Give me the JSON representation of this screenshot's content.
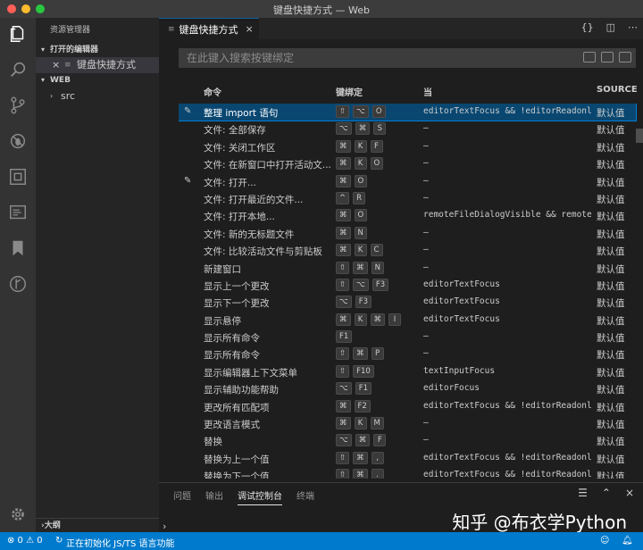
{
  "window": {
    "title": "键盘快捷方式 — Web"
  },
  "sidebar": {
    "title": "资源管理器",
    "open_editors_label": "打开的编辑器",
    "open_editor_item": "键盘快捷方式",
    "workspace_label": "WEB",
    "folder_src": "src",
    "outline_label": "大纲"
  },
  "tab": {
    "label": "键盘快捷方式",
    "close": "×"
  },
  "search": {
    "placeholder": "在此键入搜索按键绑定"
  },
  "columns": {
    "command": "命令",
    "keybinding": "键绑定",
    "when": "当",
    "source": "SOURCE"
  },
  "rows": [
    {
      "edit": "✎",
      "command": "整理 import 语句",
      "keys": [
        "⇧",
        "⌥",
        "O"
      ],
      "when": "editorTextFocus && !editorReadonly",
      "source": "默认值",
      "selected": true
    },
    {
      "edit": "",
      "command": "文件: 全部保存",
      "keys": [
        "⌥",
        "⌘",
        "S"
      ],
      "when": "—",
      "source": "默认值"
    },
    {
      "edit": "",
      "command": "文件: 关闭工作区",
      "keys": [
        "⌘",
        "K",
        "F"
      ],
      "when": "—",
      "source": "默认值"
    },
    {
      "edit": "",
      "command": "文件: 在新窗口中打开活动文...",
      "keys": [
        "⌘",
        "K",
        "O"
      ],
      "when": "—",
      "source": "默认值"
    },
    {
      "edit": "✎",
      "command": "文件: 打开...",
      "keys": [
        "⌘",
        "O"
      ],
      "when": "—",
      "source": "默认值"
    },
    {
      "edit": "",
      "command": "文件: 打开最近的文件...",
      "keys": [
        "^",
        "R"
      ],
      "when": "—",
      "source": "默认值"
    },
    {
      "edit": "",
      "command": "文件: 打开本地...",
      "keys": [
        "⌘",
        "O"
      ],
      "when": "remoteFileDialogVisible && remoteFileDialog",
      "source": "默认值"
    },
    {
      "edit": "",
      "command": "文件: 新的无标题文件",
      "keys": [
        "⌘",
        "N"
      ],
      "when": "—",
      "source": "默认值"
    },
    {
      "edit": "",
      "command": "文件: 比较活动文件与剪贴板",
      "keys": [
        "⌘",
        "K",
        "C"
      ],
      "when": "—",
      "source": "默认值"
    },
    {
      "edit": "",
      "command": "新建窗口",
      "keys": [
        "⇧",
        "⌘",
        "N"
      ],
      "when": "—",
      "source": "默认值"
    },
    {
      "edit": "",
      "command": "显示上一个更改",
      "keys": [
        "⇧",
        "⌥",
        "F3"
      ],
      "when": "editorTextFocus",
      "source": "默认值"
    },
    {
      "edit": "",
      "command": "显示下一个更改",
      "keys": [
        "⌥",
        "F3"
      ],
      "when": "editorTextFocus",
      "source": "默认值"
    },
    {
      "edit": "",
      "command": "显示悬停",
      "keys": [
        "⌘",
        "K",
        "⌘",
        "I"
      ],
      "when": "editorTextFocus",
      "source": "默认值"
    },
    {
      "edit": "",
      "command": "显示所有命令",
      "keys": [
        "F1"
      ],
      "when": "—",
      "source": "默认值"
    },
    {
      "edit": "",
      "command": "显示所有命令",
      "keys": [
        "⇧",
        "⌘",
        "P"
      ],
      "when": "—",
      "source": "默认值"
    },
    {
      "edit": "",
      "command": "显示编辑器上下文菜单",
      "keys": [
        "⇧",
        "F10"
      ],
      "when": "textInputFocus",
      "source": "默认值"
    },
    {
      "edit": "",
      "command": "显示辅助功能帮助",
      "keys": [
        "⌥",
        "F1"
      ],
      "when": "editorFocus",
      "source": "默认值"
    },
    {
      "edit": "",
      "command": "更改所有匹配项",
      "keys": [
        "⌘",
        "F2"
      ],
      "when": "editorTextFocus && !editorReadonly",
      "source": "默认值"
    },
    {
      "edit": "",
      "command": "更改语言模式",
      "keys": [
        "⌘",
        "K",
        "M"
      ],
      "when": "—",
      "source": "默认值"
    },
    {
      "edit": "",
      "command": "替换",
      "keys": [
        "⌥",
        "⌘",
        "F"
      ],
      "when": "—",
      "source": "默认值"
    },
    {
      "edit": "",
      "command": "替换为上一个值",
      "keys": [
        "⇧",
        "⌘",
        ","
      ],
      "when": "editorTextFocus && !editorReadonly",
      "source": "默认值"
    },
    {
      "edit": "",
      "command": "替换为下一个值",
      "keys": [
        "⇧",
        "⌘",
        "."
      ],
      "when": "editorTextFocus && !editorReadonly",
      "source": "默认值"
    }
  ],
  "panel": {
    "tabs": [
      "问题",
      "输出",
      "调试控制台",
      "终端"
    ],
    "active_tab": "调试控制台",
    "prompt": "›",
    "watermark": "知乎 @布衣学Python"
  },
  "statusbar": {
    "problems": "⊗ 0 ⚠ 0",
    "progress": "正在初始化 JS/TS 语言功能"
  }
}
